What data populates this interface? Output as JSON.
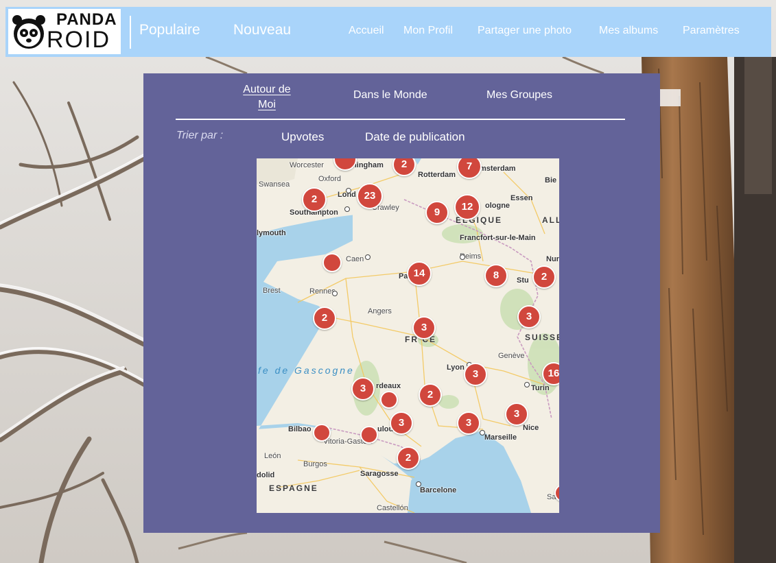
{
  "brand": {
    "logo_line1": "PANDA",
    "logo_line2": "ROID"
  },
  "header": {
    "primary_tabs": [
      "Populaire",
      "Nouveau"
    ],
    "links": [
      "Accueil",
      "Mon Profil",
      "Partager une photo",
      "Mes albums",
      "Paramètres"
    ],
    "background_color": "#a9d4fa"
  },
  "panel": {
    "background_color": "#636399",
    "tabs": [
      {
        "label_line1": "Autour de",
        "label_line2": "Moi",
        "active": true
      },
      {
        "label": "Dans le Monde",
        "active": false
      },
      {
        "label": "Mes Groupes",
        "active": false
      }
    ],
    "sort": {
      "label": "Trier par :",
      "options": [
        "Upvotes",
        "Date de publication"
      ]
    }
  },
  "map": {
    "cities": {
      "worcester": "Worcester",
      "birmingham": "mingham",
      "oxford": "Oxford",
      "swansea": "Swansea",
      "london": "Lond",
      "crawley": "Crawley",
      "southampton": "Southampton",
      "plymouth": "lymouth",
      "rotterdam": "Rotterdam",
      "amsterdam": "msterdam",
      "bielefeld": "Bie",
      "essen": "Essen",
      "cologne": "ologne",
      "belgique": "ELGIQUE",
      "allemagne": "ALL",
      "frankfurt": "Francfort-sur-le-Main",
      "caen": "Caen",
      "reims": "Reims",
      "paris": "Pa",
      "nuremberg": "Nur",
      "stuttgart": "Stu",
      "brest": "Brest",
      "rennes": "Rennes",
      "angers": "Angers",
      "france": "FR    CE",
      "suisse": "SUISSE",
      "geneve": "Genève",
      "gascogne": "fe de Gascogne",
      "lyon": "Lyon",
      "bordeaux": "rdeaux",
      "turin": "Turin",
      "bilbao": "Bilbao",
      "vitoria": "Vitoria-Gasteiz",
      "toulouse": "ulou",
      "nice": "Nice",
      "marseille": "Marseille",
      "leon": "León",
      "burgos": "Burgos",
      "valladolid": "dolid",
      "saragosse": "Saragosse",
      "espagne": "ESPAGNE",
      "barcelone": "Barcelone",
      "castellon": "Castellón",
      "sardinia": "Sa"
    },
    "clusters": [
      "2",
      "7",
      "23",
      "2",
      "12",
      "9",
      "14",
      "8",
      "2",
      "2",
      "3",
      "3",
      "3",
      "16",
      "2",
      "3",
      "3",
      "3",
      "2"
    ],
    "marker_color": "#d1473d"
  }
}
